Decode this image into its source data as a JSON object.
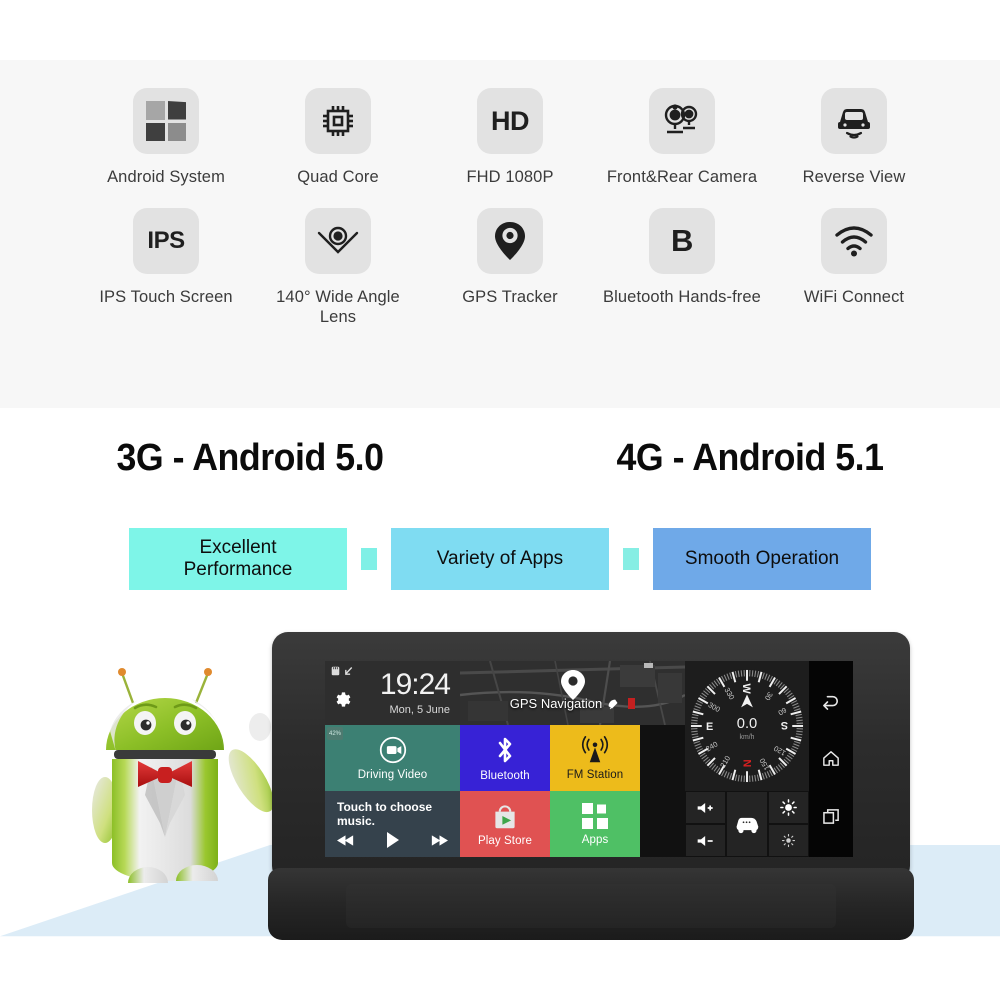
{
  "features": [
    {
      "icon": "android-windows-icon",
      "label": "Android System"
    },
    {
      "icon": "cpu-chip-icon",
      "label": "Quad Core"
    },
    {
      "icon": "hd-text-icon",
      "label": "FHD 1080P",
      "icon_text": "HD"
    },
    {
      "icon": "dual-camera-icon",
      "label": "Front&Rear Camera"
    },
    {
      "icon": "car-reverse-icon",
      "label": "Reverse View"
    },
    {
      "icon": "ips-text-icon",
      "label": "IPS Touch Screen",
      "icon_text": "IPS"
    },
    {
      "icon": "wide-lens-icon",
      "label": "140° Wide Angle Lens"
    },
    {
      "icon": "gps-pin-icon",
      "label": "GPS Tracker"
    },
    {
      "icon": "bluetooth-b-icon",
      "label": "Bluetooth Hands-free",
      "icon_text": "B"
    },
    {
      "icon": "wifi-icon",
      "label": "WiFi Connect"
    }
  ],
  "versions": [
    {
      "label": "3G - Android 5.0"
    },
    {
      "label": "4G - Android 5.1"
    }
  ],
  "pills": [
    {
      "label": "Excellent Performance",
      "color": "#7ef5e8"
    },
    {
      "label": "Variety of Apps",
      "color": "#7fdcf2"
    },
    {
      "label": "Smooth Operation",
      "color": "#6fa9e8"
    }
  ],
  "device": {
    "screen": {
      "clock": {
        "time": "19:24",
        "date": "Mon, 5 June",
        "battery_badge": "42%"
      },
      "gps": {
        "label": "GPS Navigation"
      },
      "tiles": [
        {
          "name": "driving-video",
          "label": "Driving Video",
          "color": "#3c8073"
        },
        {
          "name": "bluetooth",
          "label": "Bluetooth",
          "color": "#3722d6"
        },
        {
          "name": "fm-station",
          "label": "FM Station",
          "color": "#edbb1b"
        },
        {
          "name": "music",
          "label": "Touch to choose music.",
          "color": "#35424c"
        },
        {
          "name": "play-store",
          "label": "Play Store",
          "color": "#e05252"
        },
        {
          "name": "apps",
          "label": "Apps",
          "color": "#4fc065"
        }
      ],
      "compass": {
        "speed": "0.0",
        "unit": "km/h",
        "cardinals": [
          "E",
          "S",
          "W",
          "N"
        ],
        "degrees": [
          "30",
          "60",
          "120",
          "150",
          "210",
          "240",
          "300",
          "330"
        ],
        "north_color": "#d92121"
      },
      "controls": [
        {
          "name": "volume-up-button",
          "icon": "speaker-plus-icon"
        },
        {
          "name": "volume-down-button",
          "icon": "speaker-minus-icon"
        },
        {
          "name": "car-mode-button",
          "icon": "car-icon"
        },
        {
          "name": "brightness-up-button",
          "icon": "sun-bright-icon"
        },
        {
          "name": "brightness-down-button",
          "icon": "sun-dim-icon"
        }
      ],
      "navbar": [
        {
          "name": "back-button",
          "icon": "back-arrow-icon"
        },
        {
          "name": "home-button",
          "icon": "home-icon"
        },
        {
          "name": "recents-button",
          "icon": "recent-apps-icon"
        }
      ]
    }
  },
  "colors": {
    "band_bg": "#f7f7f7",
    "icon_tile": "#e2e2e2",
    "floor_shadow": "#dcecf7",
    "page_bg": "#ffffff"
  }
}
